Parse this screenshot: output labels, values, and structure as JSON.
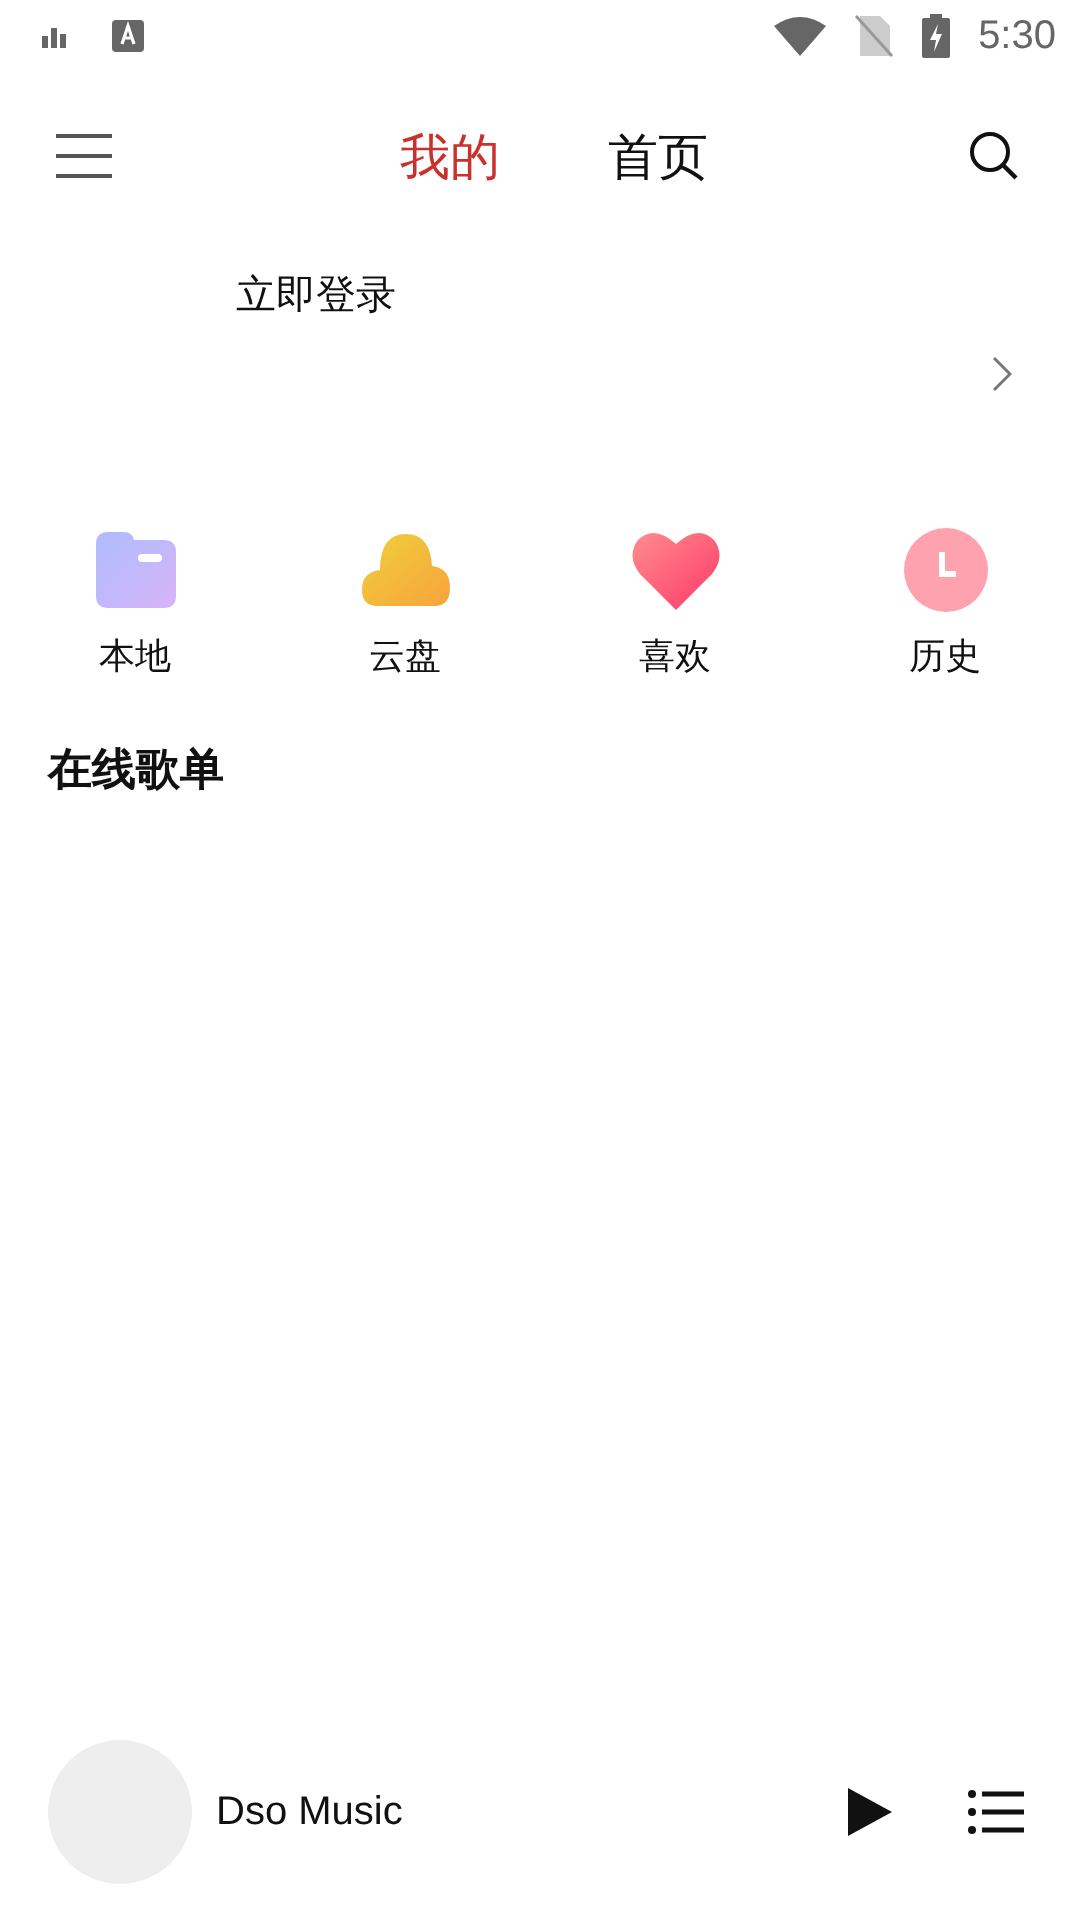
{
  "status_bar": {
    "time": "5:30"
  },
  "tabs": [
    {
      "label": "我的",
      "selected": true
    },
    {
      "label": "首页",
      "selected": false
    }
  ],
  "login": {
    "label": "立即登录"
  },
  "shortcuts": [
    {
      "kind": "folder",
      "label": "本地"
    },
    {
      "kind": "cloud",
      "label": "云盘"
    },
    {
      "kind": "heart",
      "label": "喜欢"
    },
    {
      "kind": "clock",
      "label": "历史"
    }
  ],
  "section_title": "在线歌单",
  "player": {
    "title": "Dso Music"
  }
}
